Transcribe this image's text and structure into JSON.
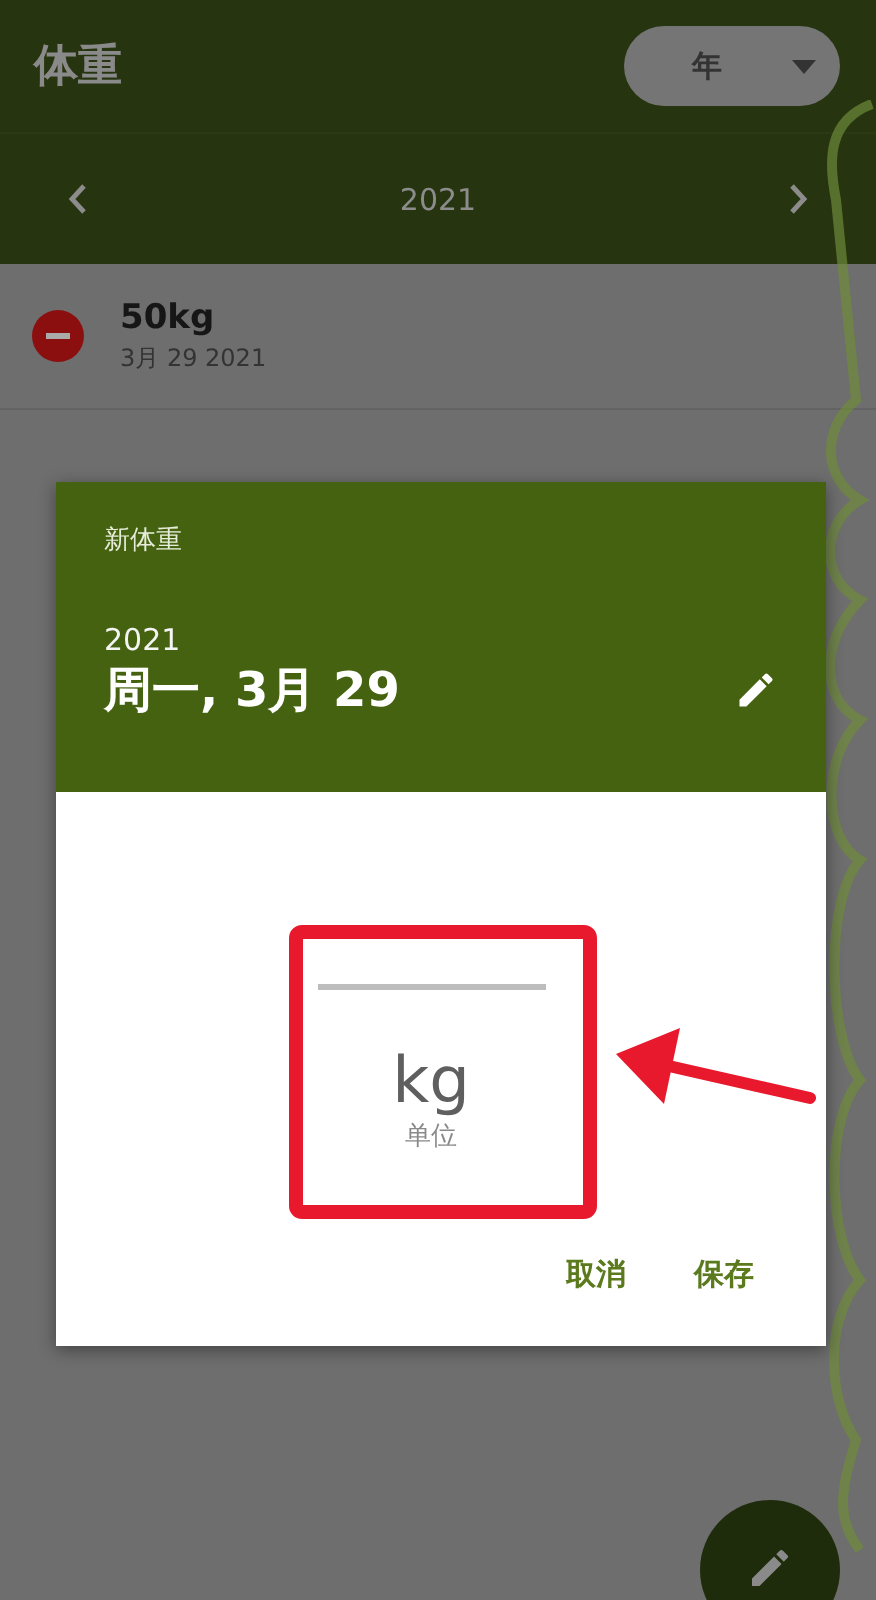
{
  "app_bar": {
    "title": "体重",
    "period_dropdown": "年"
  },
  "year_nav": {
    "year": "2021"
  },
  "entries": [
    {
      "weight": "50kg",
      "date": "3月 29 2021"
    }
  ],
  "dialog": {
    "title": "新体重",
    "year": "2021",
    "date": "周一, 3月 29",
    "unit_value": "kg",
    "unit_label": "单位",
    "buttons": [
      "取消",
      "保存"
    ]
  }
}
